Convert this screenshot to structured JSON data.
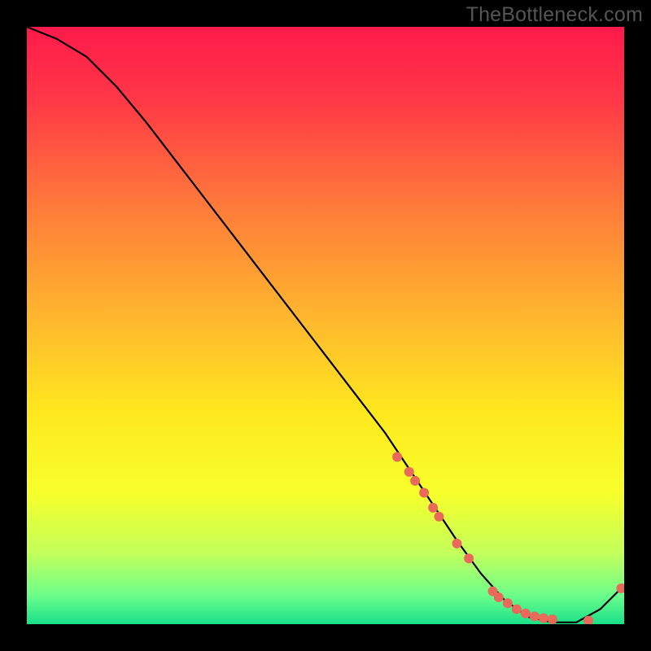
{
  "watermark": "TheBottleneck.com",
  "chart_data": {
    "type": "line",
    "title": "",
    "xlabel": "",
    "ylabel": "",
    "xlim": [
      0,
      100
    ],
    "ylim": [
      0,
      100
    ],
    "background_gradient": {
      "stops": [
        {
          "offset": 0.0,
          "color": "#ff1a4b"
        },
        {
          "offset": 0.12,
          "color": "#ff3747"
        },
        {
          "offset": 0.3,
          "color": "#ff7a3a"
        },
        {
          "offset": 0.5,
          "color": "#ffbb2d"
        },
        {
          "offset": 0.65,
          "color": "#ffe91e"
        },
        {
          "offset": 0.78,
          "color": "#f7ff2a"
        },
        {
          "offset": 0.88,
          "color": "#c4ff5a"
        },
        {
          "offset": 0.95,
          "color": "#6fff8a"
        },
        {
          "offset": 1.0,
          "color": "#1ae08a"
        }
      ]
    },
    "curve": {
      "x": [
        0,
        5,
        10,
        15,
        20,
        25,
        30,
        35,
        40,
        45,
        50,
        55,
        60,
        64,
        68,
        72,
        76,
        80,
        84,
        88,
        92,
        96,
        100
      ],
      "y": [
        100,
        98,
        95,
        90,
        84,
        77.5,
        71,
        64.5,
        58,
        51.5,
        45,
        38.5,
        32,
        26,
        20,
        14,
        8.5,
        4,
        1.2,
        0.3,
        0.3,
        2.5,
        6.5
      ]
    },
    "scatter": {
      "x": [
        62,
        64,
        65,
        66.5,
        68,
        69,
        72,
        74,
        78,
        79,
        80.5,
        82,
        83.5,
        85,
        86.5,
        88,
        94,
        99.5
      ],
      "y": [
        28,
        25.5,
        24,
        22,
        19.5,
        18,
        13.5,
        11,
        5.5,
        4.5,
        3.5,
        2.5,
        1.8,
        1.3,
        1.0,
        0.8,
        0.6,
        6.0
      ],
      "color": "#e9695a",
      "radius": 6
    }
  }
}
